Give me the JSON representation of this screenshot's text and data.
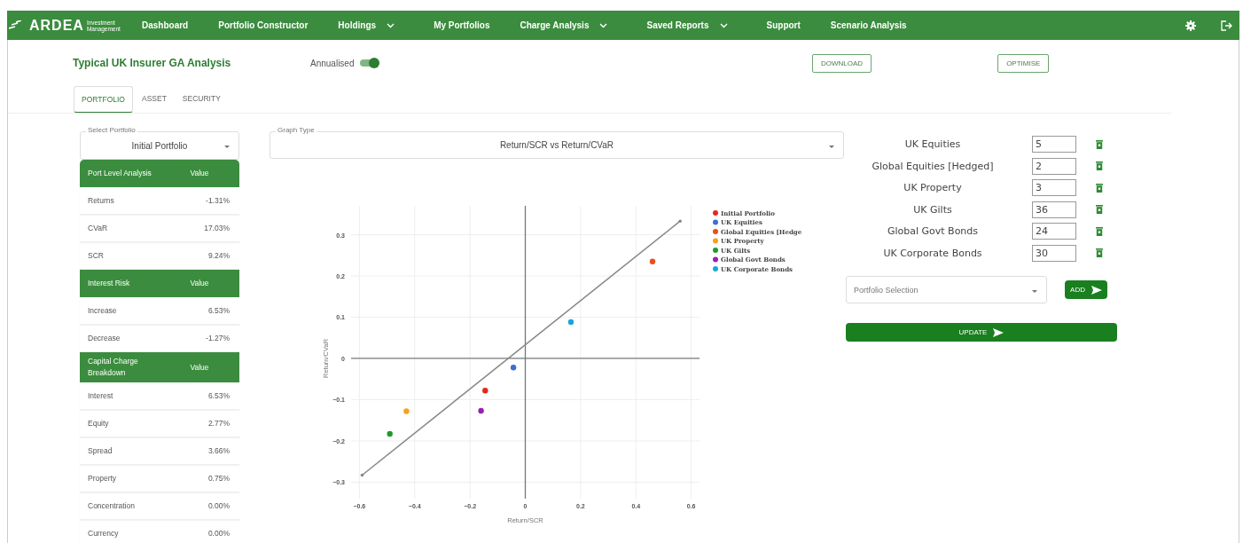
{
  "nav": {
    "logo": {
      "name": "ARDEA",
      "tagline_1": "Investment",
      "tagline_2": "Management"
    },
    "items": [
      {
        "label": "Dashboard",
        "dropdown": false
      },
      {
        "label": "Portfolio Constructor",
        "dropdown": false
      },
      {
        "label": "Holdings",
        "dropdown": true
      },
      {
        "label": "My Portfolios",
        "dropdown": false
      },
      {
        "label": "Charge Analysis",
        "dropdown": true
      },
      {
        "label": "Saved Reports",
        "dropdown": true
      },
      {
        "label": "Support",
        "dropdown": false
      },
      {
        "label": "Scenario Analysis",
        "dropdown": false
      }
    ]
  },
  "header": {
    "title": "Typical UK Insurer GA Analysis",
    "toggle": {
      "label": "Annualised",
      "on": true
    },
    "buttons": [
      "DOWNLOAD",
      "OPTIMISE"
    ]
  },
  "tabs": [
    {
      "label": "PORTFOLIO",
      "selected": true
    },
    {
      "label": "ASSET",
      "selected": false
    },
    {
      "label": "SECURITY",
      "selected": false
    }
  ],
  "portfolio_select": {
    "label": "Select Portfolio",
    "value": "Initial Portfolio"
  },
  "sections": [
    {
      "header": "Port Level Analysis",
      "value_header": "Value",
      "rows": [
        {
          "label": "Returns",
          "value": "-1.31%"
        },
        {
          "label": "CVaR",
          "value": "17.03%"
        },
        {
          "label": "SCR",
          "value": "9.24%"
        }
      ]
    },
    {
      "header": "Interest Risk",
      "value_header": "Value",
      "rows": [
        {
          "label": "Increase",
          "value": "6.53%"
        },
        {
          "label": "Decrease",
          "value": "-1.27%"
        }
      ]
    },
    {
      "header": "Capital Charge Breakdown",
      "value_header": "Value",
      "rows": [
        {
          "label": "Interest",
          "value": "6.53%"
        },
        {
          "label": "Equity",
          "value": "2.77%"
        },
        {
          "label": "Spread",
          "value": "3.66%"
        },
        {
          "label": "Property",
          "value": "0.75%"
        },
        {
          "label": "Concentration",
          "value": "0.00%"
        },
        {
          "label": "Currency",
          "value": "0.00%"
        }
      ]
    }
  ],
  "graph_select": {
    "label": "Graph Type",
    "value": "Return/SCR vs Return/CVaR"
  },
  "chart": {
    "chart_data": {
      "type": "scatter",
      "grid": true,
      "legend": "right",
      "xlabel": "Return/SCR",
      "ylabel": "Return/CVaR",
      "xlim": [
        -0.63,
        0.63
      ],
      "ylim": [
        -0.34,
        0.37
      ],
      "xticks": [
        {
          "value": -0.6,
          "label": "−0.6"
        },
        {
          "value": -0.4,
          "label": "−0.4"
        },
        {
          "value": -0.2,
          "label": "−0.2"
        },
        {
          "value": 0,
          "label": "0"
        },
        {
          "value": 0.2,
          "label": "0.2"
        },
        {
          "value": 0.4,
          "label": "0.4"
        },
        {
          "value": 0.6,
          "label": "0.6"
        }
      ],
      "yticks": [
        {
          "value": -0.3,
          "label": "−0.3"
        },
        {
          "value": -0.2,
          "label": "−0.2"
        },
        {
          "value": -0.1,
          "label": "−0.1"
        },
        {
          "value": 0,
          "label": "0"
        },
        {
          "value": 0.1,
          "label": "0.1"
        },
        {
          "value": 0.2,
          "label": "0.2"
        },
        {
          "value": 0.3,
          "label": "0.3"
        }
      ],
      "series": [
        {
          "name": "Initial Portfolio",
          "color": "#e8261c",
          "x": [
            -0.145
          ],
          "values": [
            -0.078
          ]
        },
        {
          "name": "UK Equities",
          "color": "#3b6fd8",
          "x": [
            -0.043
          ],
          "values": [
            -0.022
          ]
        },
        {
          "name": "Global Equities [Hedge",
          "color": "#e8501c",
          "x": [
            0.46
          ],
          "values": [
            0.235
          ]
        },
        {
          "name": "UK Property",
          "color": "#f5a21c",
          "x": [
            -0.43
          ],
          "values": [
            -0.128
          ]
        },
        {
          "name": "UK Gilts",
          "color": "#1f9a2a",
          "x": [
            -0.49
          ],
          "values": [
            -0.183
          ]
        },
        {
          "name": "Global Govt Bonds",
          "color": "#9a1fb0",
          "x": [
            -0.16
          ],
          "values": [
            -0.127
          ]
        },
        {
          "name": "UK Corporate Bonds",
          "color": "#1aa5d8",
          "x": [
            0.165
          ],
          "values": [
            0.088
          ]
        },
        {
          "type": "line",
          "color": "#888888",
          "x": [
            -0.59,
            0.56
          ],
          "values": [
            -0.283,
            0.333
          ]
        }
      ]
    }
  },
  "allocations": [
    {
      "name": "UK Equities",
      "value": "5"
    },
    {
      "name": "Global Equities [Hedged]",
      "value": "2"
    },
    {
      "name": "UK Property",
      "value": "3"
    },
    {
      "name": "UK Gilts",
      "value": "36"
    },
    {
      "name": "Global Govt Bonds",
      "value": "24"
    },
    {
      "name": "UK Corporate Bonds",
      "value": "30"
    }
  ],
  "portfolio_selection": {
    "placeholder": "Portfolio Selection"
  },
  "add_button": "ADD",
  "update_button": "UPDATE"
}
